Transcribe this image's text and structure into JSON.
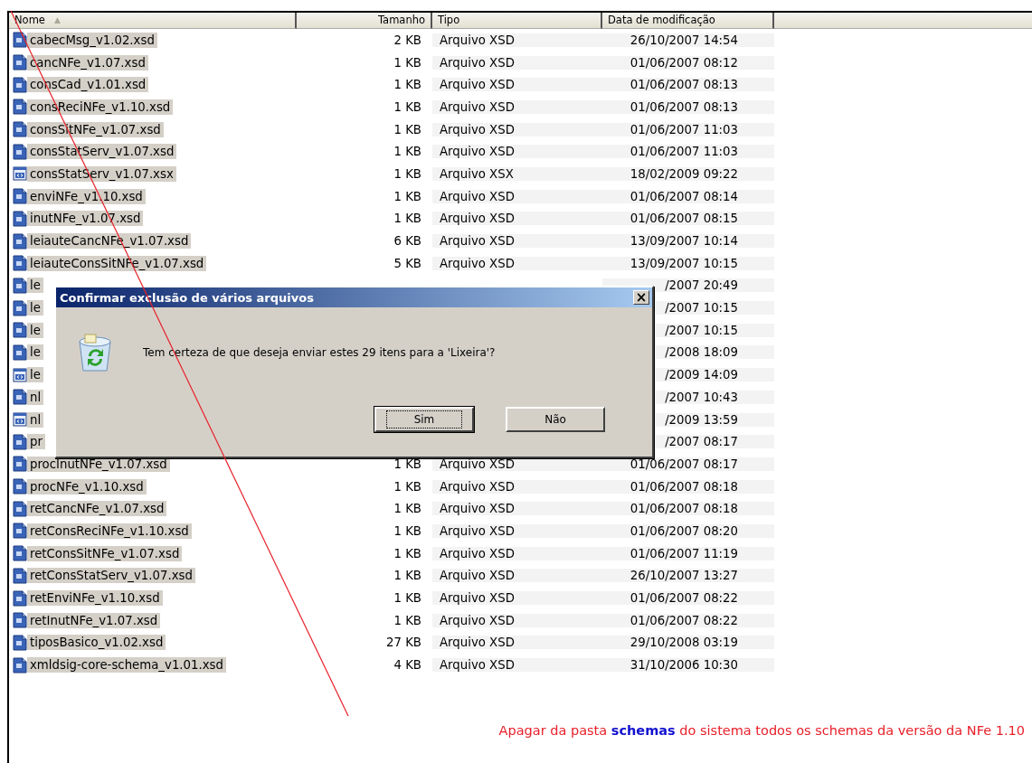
{
  "columns": [
    "Nome",
    "Tamanho",
    "Tipo",
    "Data de modificação"
  ],
  "sort_indicator": "▲",
  "rows": [
    {
      "kind": "xsd",
      "name": "cabecMsg_v1.02.xsd",
      "size": "2 KB",
      "type": "Arquivo XSD",
      "modified": "26/10/2007 14:54",
      "selected": true
    },
    {
      "kind": "xsd",
      "name": "cancNFe_v1.07.xsd",
      "size": "1 KB",
      "type": "Arquivo XSD",
      "modified": "01/06/2007 08:12",
      "selected": true
    },
    {
      "kind": "xsd",
      "name": "consCad_v1.01.xsd",
      "size": "1 KB",
      "type": "Arquivo XSD",
      "modified": "01/06/2007 08:13",
      "selected": true
    },
    {
      "kind": "xsd",
      "name": "consReciNFe_v1.10.xsd",
      "size": "1 KB",
      "type": "Arquivo XSD",
      "modified": "01/06/2007 08:13",
      "selected": true
    },
    {
      "kind": "xsd",
      "name": "consSitNFe_v1.07.xsd",
      "size": "1 KB",
      "type": "Arquivo XSD",
      "modified": "01/06/2007 11:03",
      "selected": true
    },
    {
      "kind": "xsd",
      "name": "consStatServ_v1.07.xsd",
      "size": "1 KB",
      "type": "Arquivo XSD",
      "modified": "01/06/2007 11:03",
      "selected": true
    },
    {
      "kind": "xsx",
      "name": "consStatServ_v1.07.xsx",
      "size": "1 KB",
      "type": "Arquivo XSX",
      "modified": "18/02/2009 09:22",
      "selected": true
    },
    {
      "kind": "xsd",
      "name": "enviNFe_v1.10.xsd",
      "size": "1 KB",
      "type": "Arquivo XSD",
      "modified": "01/06/2007 08:14",
      "selected": true
    },
    {
      "kind": "xsd",
      "name": "inutNFe_v1.07.xsd",
      "size": "1 KB",
      "type": "Arquivo XSD",
      "modified": "01/06/2007 08:15",
      "selected": true
    },
    {
      "kind": "xsd",
      "name": "leiauteCancNFe_v1.07.xsd",
      "size": "6 KB",
      "type": "Arquivo XSD",
      "modified": "13/09/2007 10:14",
      "selected": true
    },
    {
      "kind": "xsd",
      "name": "leiauteConsSitNFe_v1.07.xsd",
      "size": "5 KB",
      "type": "Arquivo XSD",
      "modified": "13/09/2007 10:15",
      "selected": true
    },
    {
      "kind": "xsd",
      "name": "le",
      "modified": "/2007 20:49",
      "selected": true
    },
    {
      "kind": "xsd",
      "name": "le",
      "modified": "/2007 10:15",
      "selected": true
    },
    {
      "kind": "xsd",
      "name": "le",
      "modified": "/2007 10:15",
      "selected": true
    },
    {
      "kind": "xsd",
      "name": "le",
      "modified": "/2008 18:09",
      "selected": true
    },
    {
      "kind": "xsx",
      "name": "le",
      "modified": "/2009 14:09",
      "selected": true
    },
    {
      "kind": "xsd",
      "name": "nl",
      "modified": "/2007 10:43",
      "selected": true
    },
    {
      "kind": "xsx",
      "name": "nl",
      "modified": "/2009 13:59",
      "selected": true
    },
    {
      "kind": "xsd",
      "name": "pr",
      "modified": "/2007 08:17",
      "selected": true
    },
    {
      "kind": "xsd",
      "name": "procInutNFe_v1.07.xsd",
      "size": "1 KB",
      "type": "Arquivo XSD",
      "modified": "01/06/2007 08:17",
      "selected": true
    },
    {
      "kind": "xsd",
      "name": "procNFe_v1.10.xsd",
      "size": "1 KB",
      "type": "Arquivo XSD",
      "modified": "01/06/2007 08:18",
      "selected": true
    },
    {
      "kind": "xsd",
      "name": "retCancNFe_v1.07.xsd",
      "size": "1 KB",
      "type": "Arquivo XSD",
      "modified": "01/06/2007 08:18",
      "selected": true
    },
    {
      "kind": "xsd",
      "name": "retConsReciNFe_v1.10.xsd",
      "size": "1 KB",
      "type": "Arquivo XSD",
      "modified": "01/06/2007 08:20",
      "selected": true
    },
    {
      "kind": "xsd",
      "name": "retConsSitNFe_v1.07.xsd",
      "size": "1 KB",
      "type": "Arquivo XSD",
      "modified": "01/06/2007 11:19",
      "selected": true
    },
    {
      "kind": "xsd",
      "name": "retConsStatServ_v1.07.xsd",
      "size": "1 KB",
      "type": "Arquivo XSD",
      "modified": "26/10/2007 13:27",
      "selected": true
    },
    {
      "kind": "xsd",
      "name": "retEnviNFe_v1.10.xsd",
      "size": "1 KB",
      "type": "Arquivo XSD",
      "modified": "01/06/2007 08:22",
      "selected": true
    },
    {
      "kind": "xsd",
      "name": "retInutNFe_v1.07.xsd",
      "size": "1 KB",
      "type": "Arquivo XSD",
      "modified": "01/06/2007 08:22",
      "selected": true
    },
    {
      "kind": "xsd",
      "name": "tiposBasico_v1.02.xsd",
      "size": "27 KB",
      "type": "Arquivo XSD",
      "modified": "29/10/2008 03:19",
      "selected": true
    },
    {
      "kind": "xsd",
      "name": "xmldsig-core-schema_v1.01.xsd",
      "size": "4 KB",
      "type": "Arquivo XSD",
      "modified": "31/10/2006 10:30",
      "selected": true
    }
  ],
  "dialog": {
    "title": "Confirmar exclusão de vários arquivos",
    "close": "×",
    "message": "Tem certeza de que deseja enviar estes 29 itens para a 'Lixeira'?",
    "buttons": [
      {
        "label": "Sim",
        "focused": true
      },
      {
        "label": "Não",
        "focused": false
      }
    ]
  },
  "annotation": "Apagar da pasta **schemas** do sistema todos os schemas da versão da NFe 1.10"
}
